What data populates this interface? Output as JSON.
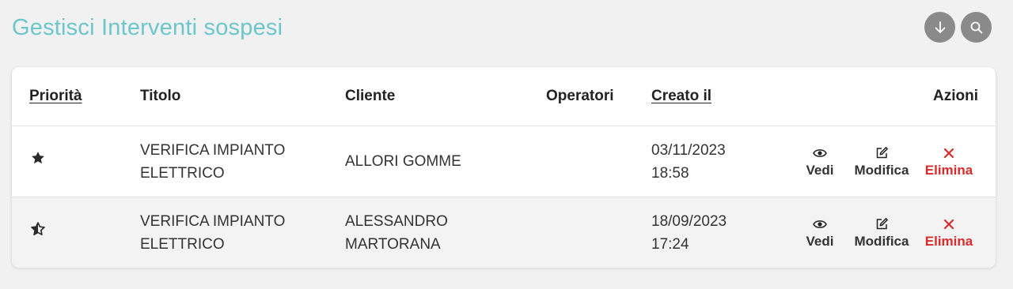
{
  "header": {
    "title": "Gestisci Interventi sospesi",
    "title_color": "#6cc7cc",
    "buttons": [
      {
        "icon": "arrow-down-icon"
      },
      {
        "icon": "search-icon"
      }
    ]
  },
  "table": {
    "columns": {
      "priority": "Priorità",
      "title": "Titolo",
      "client": "Cliente",
      "operators": "Operatori",
      "created": "Creato il",
      "actions": "Azioni"
    },
    "rows": [
      {
        "priority_icon": "star-filled-icon",
        "title_line1": "VERIFICA IMPIANTO",
        "title_line2": "ELETTRICO",
        "client_line1": "ALLORI GOMME",
        "client_line2": "",
        "operators": "",
        "date": "03/11/2023",
        "time": "18:58"
      },
      {
        "priority_icon": "star-half-icon",
        "title_line1": "VERIFICA IMPIANTO",
        "title_line2": "ELETTRICO",
        "client_line1": "ALESSANDRO",
        "client_line2": "MARTORANA",
        "operators": "",
        "date": "18/09/2023",
        "time": "17:24"
      }
    ],
    "actions": {
      "view": "Vedi",
      "edit": "Modifica",
      "delete": "Elimina"
    }
  },
  "colors": {
    "delete": "#d92b2b",
    "icon_button_bg": "#8a8a8a"
  }
}
